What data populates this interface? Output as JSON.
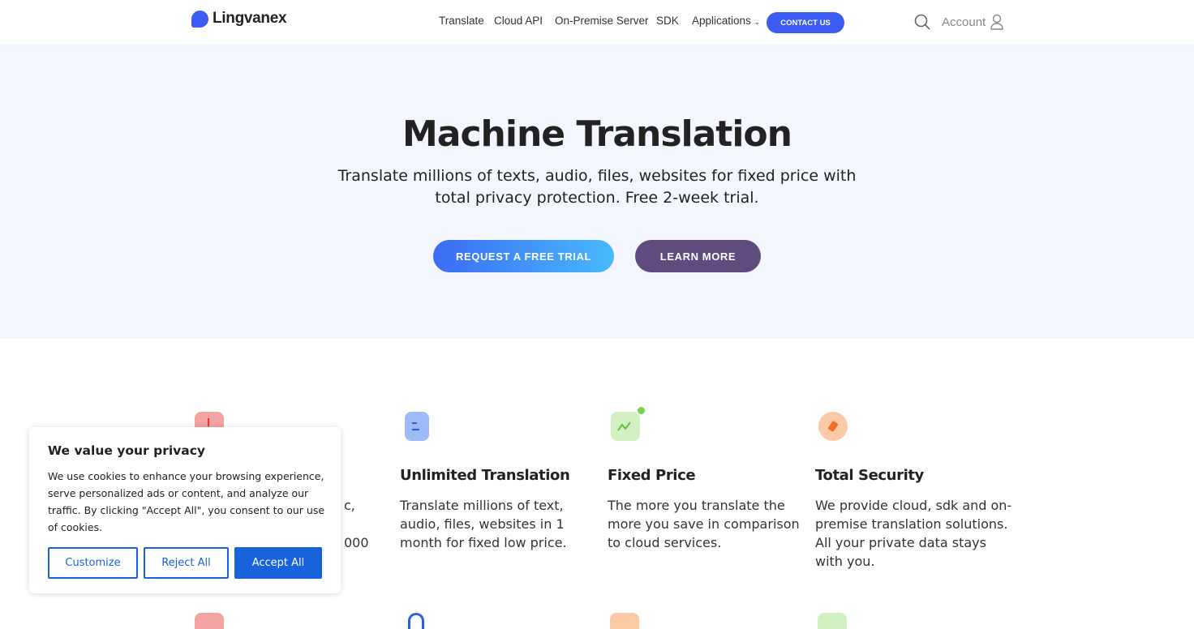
{
  "header": {
    "brand": "Lingvanex",
    "nav": [
      "Translate",
      "Cloud API",
      "On-Premise Server",
      "SDK",
      "Applications"
    ],
    "contact": "CONTACT US",
    "account": "Account"
  },
  "hero": {
    "title": "Machine Translation",
    "subtitle_line1": "Translate millions of texts, audio, files, websites for fixed price with",
    "subtitle_line2": "total privacy protection. Free 2-week trial.",
    "primary_button": "REQUEST A FREE TRIAL",
    "secondary_button": "LEARN MORE"
  },
  "features": [
    {
      "fragments": [
        "c,",
        "000"
      ],
      "icon": "chart-icon",
      "color": "#f4a3a3"
    },
    {
      "title": "Unlimited Translation",
      "body": "Translate millions of text, audio, files, websites in 1 month for fixed low price.",
      "icon": "document-icon",
      "color": "#9dbcf7"
    },
    {
      "title": "Fixed Price",
      "body": "The more you translate the more you save in comparison to cloud services.",
      "icon": "trend-icon",
      "color": "#d3f0c2"
    },
    {
      "title": "Total Security",
      "body": "We provide cloud, sdk and on-premise translation solutions. All your private data stays with you.",
      "icon": "compass-icon",
      "color": "#fdcaa8"
    }
  ],
  "cookie": {
    "title": "We value your privacy",
    "body": "We use cookies to enhance your browsing experience, serve personalized ads or content, and analyze our traffic. By clicking \"Accept All\", you consent to our use of cookies.",
    "customize": "Customize",
    "reject": "Reject All",
    "accept": "Accept All"
  }
}
